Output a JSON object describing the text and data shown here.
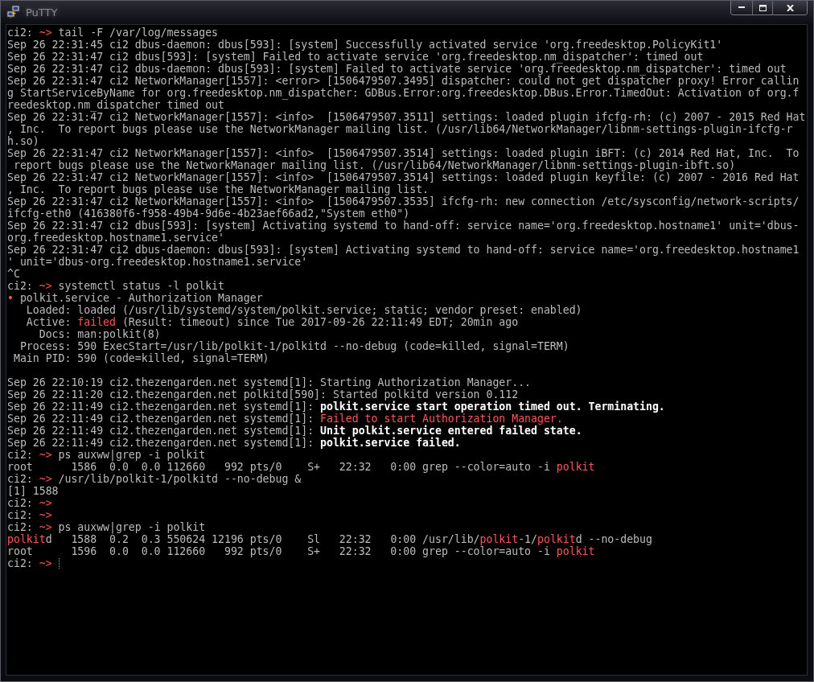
{
  "window": {
    "title": "PuTTY"
  },
  "terminal": {
    "lines": [
      {
        "kind": "text",
        "segments": [
          {
            "text": "ci2: ",
            "kind": "plain"
          },
          {
            "text": "~>",
            "kind": "red"
          },
          {
            "text": " tail -F /var/log/messages",
            "kind": "plain"
          }
        ]
      },
      {
        "kind": "text",
        "segments": [
          {
            "text": "Sep 26 22:31:45 ci2 dbus-daemon: dbus[593]: [system] Successfully activated service 'org.freedesktop.PolicyKit1'",
            "kind": "plain"
          }
        ]
      },
      {
        "kind": "text",
        "segments": [
          {
            "text": "Sep 26 22:31:47 ci2 dbus[593]: [system] Failed to activate service 'org.freedesktop.nm_dispatcher': timed out",
            "kind": "plain"
          }
        ]
      },
      {
        "kind": "text",
        "segments": [
          {
            "text": "Sep 26 22:31:47 ci2 dbus-daemon: dbus[593]: [system] Failed to activate service 'org.freedesktop.nm_dispatcher': timed out",
            "kind": "plain"
          }
        ]
      },
      {
        "kind": "text",
        "segments": [
          {
            "text": "Sep 26 22:31:47 ci2 NetworkManager[1557]: <error> [1506479507.3495] dispatcher: could not get dispatcher proxy! Error callin",
            "kind": "plain"
          }
        ]
      },
      {
        "kind": "text",
        "segments": [
          {
            "text": "g StartServiceByName for org.freedesktop.nm_dispatcher: GDBus.Error:org.freedesktop.DBus.Error.TimedOut: Activation of org.f",
            "kind": "plain"
          }
        ]
      },
      {
        "kind": "text",
        "segments": [
          {
            "text": "reedesktop.nm_dispatcher timed out",
            "kind": "plain"
          }
        ]
      },
      {
        "kind": "text",
        "segments": [
          {
            "text": "Sep 26 22:31:47 ci2 NetworkManager[1557]: <info>  [1506479507.3511] settings: loaded plugin ifcfg-rh: (c) 2007 - 2015 Red Hat",
            "kind": "plain"
          }
        ]
      },
      {
        "kind": "text",
        "segments": [
          {
            "text": ", Inc.  To report bugs please use the NetworkManager mailing list. (/usr/lib64/NetworkManager/libnm-settings-plugin-ifcfg-r",
            "kind": "plain"
          }
        ]
      },
      {
        "kind": "text",
        "segments": [
          {
            "text": "h.so)",
            "kind": "plain"
          }
        ]
      },
      {
        "kind": "text",
        "segments": [
          {
            "text": "Sep 26 22:31:47 ci2 NetworkManager[1557]: <info>  [1506479507.3514] settings: loaded plugin iBFT: (c) 2014 Red Hat, Inc.  To",
            "kind": "plain"
          }
        ]
      },
      {
        "kind": "text",
        "segments": [
          {
            "text": " report bugs please use the NetworkManager mailing list. (/usr/lib64/NetworkManager/libnm-settings-plugin-ibft.so)",
            "kind": "plain"
          }
        ]
      },
      {
        "kind": "text",
        "segments": [
          {
            "text": "Sep 26 22:31:47 ci2 NetworkManager[1557]: <info>  [1506479507.3514] settings: loaded plugin keyfile: (c) 2007 - 2016 Red Hat",
            "kind": "plain"
          }
        ]
      },
      {
        "kind": "text",
        "segments": [
          {
            "text": ", Inc.  To report bugs please use the NetworkManager mailing list.",
            "kind": "plain"
          }
        ]
      },
      {
        "kind": "text",
        "segments": [
          {
            "text": "Sep 26 22:31:47 ci2 NetworkManager[1557]: <info>  [1506479507.3535] ifcfg-rh: new connection /etc/sysconfig/network-scripts/",
            "kind": "plain"
          }
        ]
      },
      {
        "kind": "text",
        "segments": [
          {
            "text": "ifcfg-eth0 (416380f6-f958-49b4-9d6e-4b23aef66ad2,\"System eth0\")",
            "kind": "plain"
          }
        ]
      },
      {
        "kind": "text",
        "segments": [
          {
            "text": "Sep 26 22:31:47 ci2 dbus[593]: [system] Activating systemd to hand-off: service name='org.freedesktop.hostname1' unit='dbus-",
            "kind": "plain"
          }
        ]
      },
      {
        "kind": "text",
        "segments": [
          {
            "text": "org.freedesktop.hostname1.service'",
            "kind": "plain"
          }
        ]
      },
      {
        "kind": "text",
        "segments": [
          {
            "text": "Sep 26 22:31:47 ci2 dbus-daemon: dbus[593]: [system] Activating systemd to hand-off: service name='org.freedesktop.hostname1",
            "kind": "plain"
          }
        ]
      },
      {
        "kind": "text",
        "segments": [
          {
            "text": "' unit='dbus-org.freedesktop.hostname1.service'",
            "kind": "plain"
          }
        ]
      },
      {
        "kind": "text",
        "segments": [
          {
            "text": "^C",
            "kind": "plain"
          }
        ]
      },
      {
        "kind": "text",
        "segments": [
          {
            "text": "ci2: ",
            "kind": "plain"
          },
          {
            "text": "~>",
            "kind": "red"
          },
          {
            "text": " systemctl status -l polkit",
            "kind": "plain"
          }
        ]
      },
      {
        "kind": "text",
        "segments": [
          {
            "text": "•",
            "kind": "red"
          },
          {
            "text": " polkit.service - Authorization Manager",
            "kind": "plain"
          }
        ]
      },
      {
        "kind": "text",
        "segments": [
          {
            "text": "   Loaded: loaded (/usr/lib/systemd/system/polkit.service; static; vendor preset: enabled)",
            "kind": "plain"
          }
        ]
      },
      {
        "kind": "text",
        "segments": [
          {
            "text": "   Active: ",
            "kind": "plain"
          },
          {
            "text": "failed",
            "kind": "red"
          },
          {
            "text": " (Result: timeout) since Tue 2017-09-26 22:11:49 EDT; 20min ago",
            "kind": "plain"
          }
        ]
      },
      {
        "kind": "text",
        "segments": [
          {
            "text": "     Docs: man:polkit(8)",
            "kind": "plain"
          }
        ]
      },
      {
        "kind": "text",
        "segments": [
          {
            "text": "  Process: 590 ExecStart=/usr/lib/polkit-1/polkitd --no-debug (code=killed, signal=TERM)",
            "kind": "plain"
          }
        ]
      },
      {
        "kind": "text",
        "segments": [
          {
            "text": " Main PID: 590 (code=killed, signal=TERM)",
            "kind": "plain"
          }
        ]
      },
      {
        "kind": "blank"
      },
      {
        "kind": "text",
        "segments": [
          {
            "text": "Sep 26 22:10:19 ci2.thezengarden.net systemd[1]: Starting Authorization Manager...",
            "kind": "plain"
          }
        ]
      },
      {
        "kind": "text",
        "segments": [
          {
            "text": "Sep 26 22:11:20 ci2.thezengarden.net polkitd[590]: Started polkitd version 0.112",
            "kind": "plain"
          }
        ]
      },
      {
        "kind": "text",
        "segments": [
          {
            "text": "Sep 26 22:11:49 ci2.thezengarden.net systemd[1]: ",
            "kind": "plain"
          },
          {
            "text": "polkit.service start operation timed out. Terminating.",
            "kind": "bold"
          }
        ]
      },
      {
        "kind": "text",
        "segments": [
          {
            "text": "Sep 26 22:11:49 ci2.thezengarden.net systemd[1]: ",
            "kind": "plain"
          },
          {
            "text": "Failed to start Authorization Manager.",
            "kind": "red"
          }
        ]
      },
      {
        "kind": "text",
        "segments": [
          {
            "text": "Sep 26 22:11:49 ci2.thezengarden.net systemd[1]: ",
            "kind": "plain"
          },
          {
            "text": "Unit polkit.service entered failed state.",
            "kind": "bold"
          }
        ]
      },
      {
        "kind": "text",
        "segments": [
          {
            "text": "Sep 26 22:11:49 ci2.thezengarden.net systemd[1]: ",
            "kind": "plain"
          },
          {
            "text": "polkit.service failed.",
            "kind": "bold"
          }
        ]
      },
      {
        "kind": "text",
        "segments": [
          {
            "text": "ci2: ",
            "kind": "plain"
          },
          {
            "text": "~>",
            "kind": "red"
          },
          {
            "text": " ps auxww|grep -i polkit",
            "kind": "plain"
          }
        ]
      },
      {
        "kind": "text",
        "segments": [
          {
            "text": "root      1586  0.0  0.0 112660   992 pts/0    S+   22:32   0:00 grep --color=auto -i ",
            "kind": "plain"
          },
          {
            "text": "polkit",
            "kind": "red"
          }
        ]
      },
      {
        "kind": "text",
        "segments": [
          {
            "text": "ci2: ",
            "kind": "plain"
          },
          {
            "text": "~>",
            "kind": "red"
          },
          {
            "text": " /usr/lib/polkit-1/polkitd --no-debug &",
            "kind": "plain"
          }
        ]
      },
      {
        "kind": "text",
        "segments": [
          {
            "text": "[1] 1588",
            "kind": "plain"
          }
        ]
      },
      {
        "kind": "text",
        "segments": [
          {
            "text": "ci2: ",
            "kind": "plain"
          },
          {
            "text": "~>",
            "kind": "red"
          }
        ]
      },
      {
        "kind": "text",
        "segments": [
          {
            "text": "ci2: ",
            "kind": "plain"
          },
          {
            "text": "~>",
            "kind": "red"
          }
        ]
      },
      {
        "kind": "text",
        "segments": [
          {
            "text": "ci2: ",
            "kind": "plain"
          },
          {
            "text": "~>",
            "kind": "red"
          },
          {
            "text": " ps auxww|grep -i polkit",
            "kind": "plain"
          }
        ]
      },
      {
        "kind": "text",
        "segments": [
          {
            "text": "polkit",
            "kind": "red"
          },
          {
            "text": "d   1588  0.2  0.3 550624 12196 pts/0    Sl   22:32   0:00 /usr/lib/",
            "kind": "plain"
          },
          {
            "text": "polkit",
            "kind": "red"
          },
          {
            "text": "-1/",
            "kind": "plain"
          },
          {
            "text": "polkit",
            "kind": "red"
          },
          {
            "text": "d --no-debug",
            "kind": "plain"
          }
        ]
      },
      {
        "kind": "text",
        "segments": [
          {
            "text": "root      1596  0.0  0.0 112660   992 pts/0    S+   22:32   0:00 grep --color=auto -i ",
            "kind": "plain"
          },
          {
            "text": "polkit",
            "kind": "red"
          }
        ]
      },
      {
        "kind": "text",
        "segments": [
          {
            "text": "ci2: ",
            "kind": "plain"
          },
          {
            "text": "~>",
            "kind": "red"
          }
        ],
        "cursor": true
      }
    ]
  }
}
